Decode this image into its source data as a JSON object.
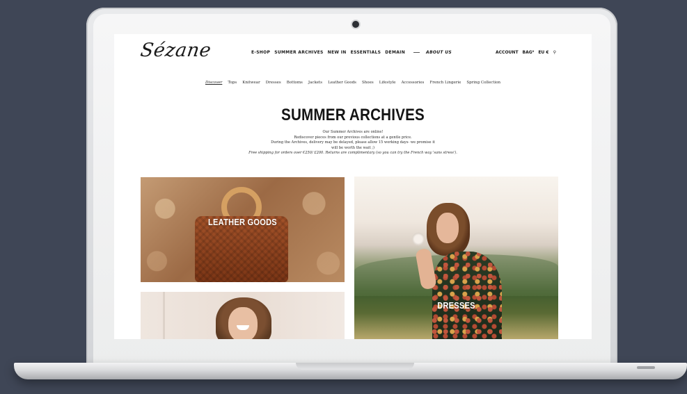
{
  "site": {
    "logo": "Sézane"
  },
  "main_nav": {
    "items": [
      "E-SHOP",
      "SUMMER ARCHIVES",
      "NEW IN",
      "ESSENTIALS",
      "DEMAIN"
    ],
    "about": "ABOUT US"
  },
  "right_nav": {
    "account": "ACCOUNT",
    "bag": "BAG⁰",
    "currency": "EU €",
    "search_icon": "search-icon"
  },
  "sub_nav": {
    "items": [
      "Discover",
      "Tops",
      "Knitwear",
      "Dresses",
      "Bottoms",
      "Jackets",
      "Leather Goods",
      "Shoes",
      "Lifestyle",
      "Accessories",
      "French Lingerie",
      "Spring Collection"
    ],
    "active": "Discover"
  },
  "page": {
    "title": "SUMMER ARCHIVES",
    "intro_line1": "Our Summer Archives are online!",
    "intro_line2": "Rediscover pieces from our previous collections at a gentle price.",
    "intro_line3": "During the Archives, delivery may be delayed, please allow 15 working days- we promise it",
    "intro_line4": "will be worth the wait ;)",
    "intro_fine": "Free shipping for orders over €250/ £200. Returns are complimentary (so you can try the French way 'sans stress')."
  },
  "tiles": {
    "leather_goods": "LEATHER GOODS",
    "dresses": "DRESSES"
  }
}
